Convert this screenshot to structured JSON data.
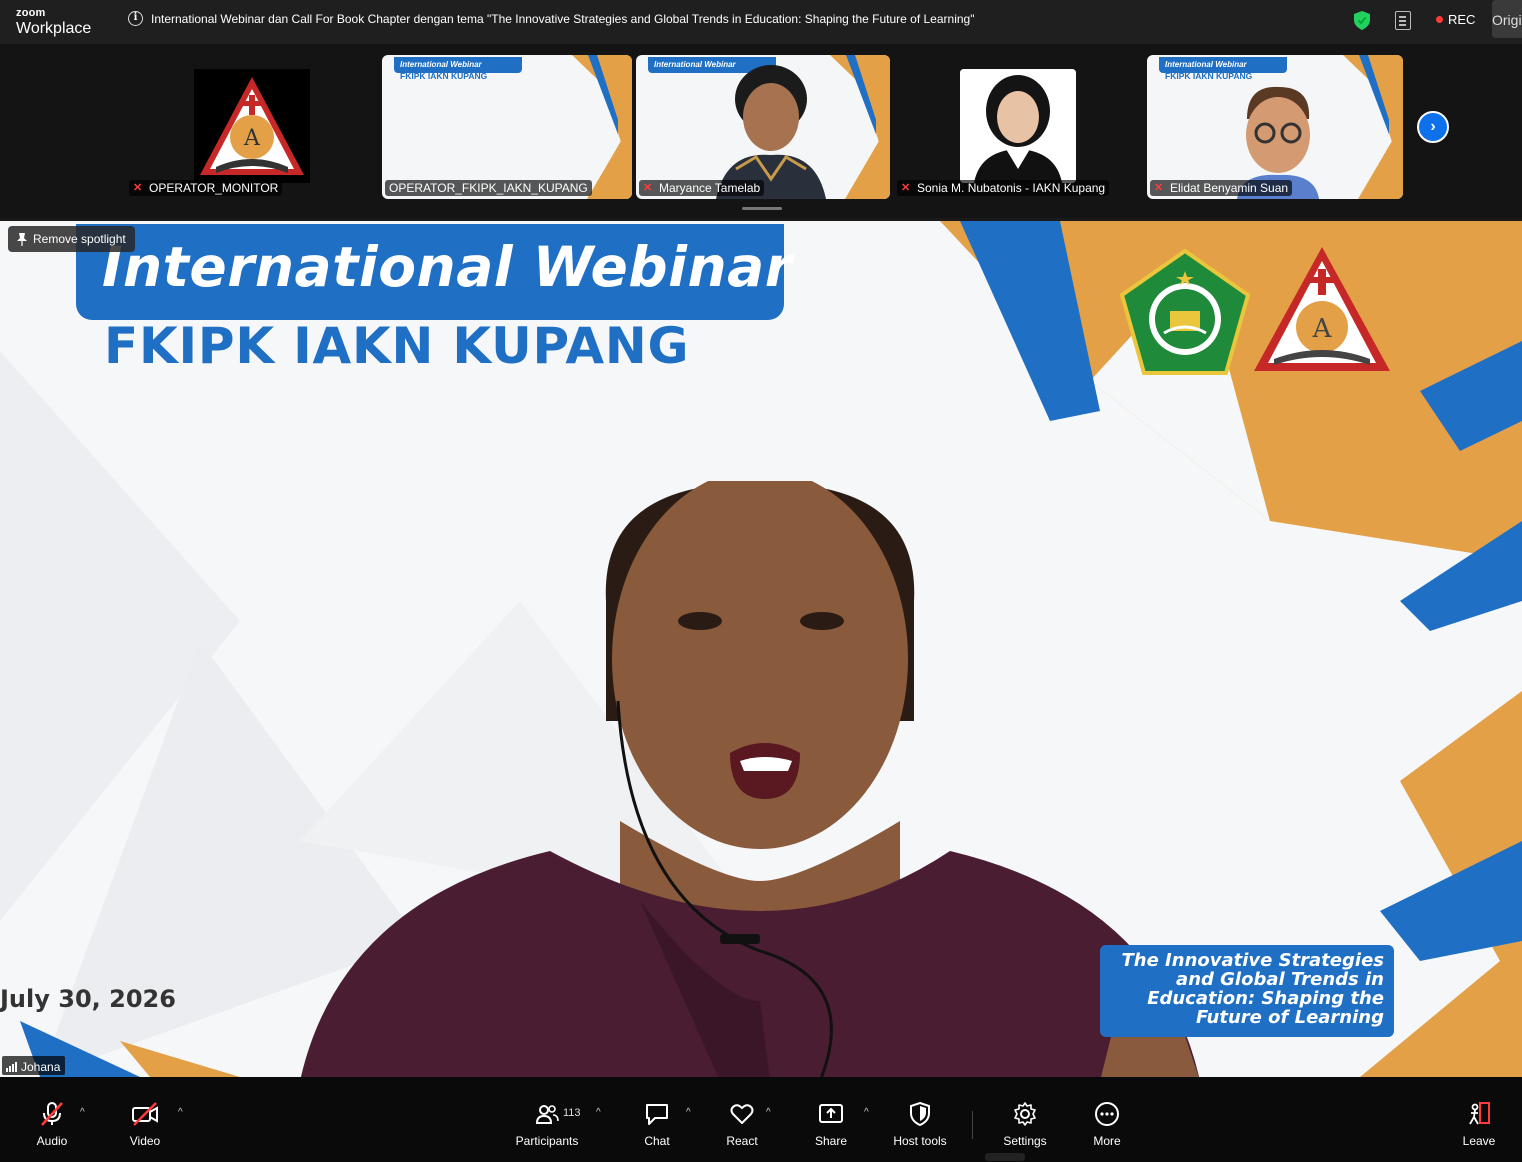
{
  "titlebar": {
    "brand_top": "zoom",
    "brand_bottom": "Workplace",
    "meeting_topic": "International Webinar dan Call For Book Chapter dengan tema \"The Innovative Strategies and Global Trends in Education: Shaping the Future of Learning\"",
    "rec_label": "REC",
    "view_label": "Original"
  },
  "thumbnails": [
    {
      "name": "OPERATOR_MONITOR"
    },
    {
      "name": "OPERATOR_FKIPK_IAKN_KUPANG"
    },
    {
      "name": "Maryance Tamelab"
    },
    {
      "name": "Sonia M. Nubatonis - IAKN Kupang"
    },
    {
      "name": "Elidat Benyamin Suan"
    }
  ],
  "thumb_slide": {
    "head": "International Webinar",
    "sub": "FKIPK IAKN KUPANG"
  },
  "stage": {
    "spotlight_label": "Remove spotlight",
    "banner_title": "International Webinar",
    "banner_sub": "FKIPK IAKN KUPANG",
    "date": "July 30, 2026",
    "theme_line1": "The Innovative Strategies",
    "theme_line2": "and Global Trends in",
    "theme_line3": "Education: Shaping the",
    "theme_line4": "Future of Learning",
    "speaker_name": "Johana"
  },
  "toolbar": {
    "audio": "Audio",
    "video": "Video",
    "participants": "Participants",
    "participants_count": "113",
    "chat": "Chat",
    "react": "React",
    "share": "Share",
    "host_tools": "Host tools",
    "settings": "Settings",
    "more": "More",
    "leave": "Leave"
  },
  "colors": {
    "brand_blue": "#1f6fc4",
    "accent_orange": "#e4a047",
    "zoom_blue": "#0e71eb",
    "rec_red": "#ff3b3b",
    "shield_green": "#23d160"
  }
}
